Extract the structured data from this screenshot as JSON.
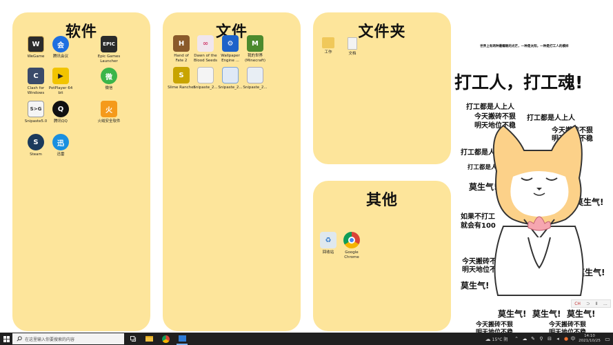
{
  "fences": {
    "software": {
      "title": "软件",
      "icons": [
        {
          "label": "WeGame",
          "color": "#2b2b2b",
          "glyph": "W"
        },
        {
          "label": "腾讯会议",
          "color": "#1e6fe0",
          "glyph": "会"
        },
        {
          "label": "Epic Games\nLauncher",
          "color": "#2a2a2a",
          "glyph": "EPIC"
        },
        {
          "label": "Clash for\nWindows",
          "color": "#3a4a6a",
          "glyph": "C"
        },
        {
          "label": "PotPlayer 64\nbit",
          "color": "#f2c400",
          "glyph": "▶"
        },
        {
          "label": "微信",
          "color": "#3bb54a",
          "glyph": "微"
        },
        {
          "label": "Snipaste5.0",
          "color": "#f5f5f5",
          "glyph": "S>G"
        },
        {
          "label": "腾讯QQ",
          "color": "#111111",
          "glyph": "Q"
        },
        {
          "label": "火绒安全软件",
          "color": "#f59a1b",
          "glyph": "火"
        },
        {
          "label": "Steam",
          "color": "#1b3a5c",
          "glyph": "S"
        },
        {
          "label": "迅雷",
          "color": "#1a8fe0",
          "glyph": "迅"
        }
      ]
    },
    "files": {
      "title": "文件",
      "icons": [
        {
          "label": "Hand of\nFate 2",
          "color": "#8a5a2b",
          "glyph": "H"
        },
        {
          "label": "Dawn of the\nBlood Seeds",
          "color": "#f0e6ee",
          "glyph": "∞"
        },
        {
          "label": "Wallpaper\nEngine ...",
          "color": "#1d62c9",
          "glyph": "⚙"
        },
        {
          "label": "我的世界\n(Minecraft)",
          "color": "#4c8a2e",
          "glyph": "M"
        },
        {
          "label": "Slime Rancher",
          "color": "#c8a400",
          "glyph": "S"
        },
        {
          "label": "Snipaste_2...",
          "color": "#f4f4f4",
          "glyph": ""
        },
        {
          "label": "Snipaste_2...",
          "color": "#dfe9f6",
          "glyph": ""
        },
        {
          "label": "Snipaste_2...",
          "color": "#e8eef4",
          "glyph": ""
        }
      ]
    },
    "folders": {
      "title": "文件夹",
      "icons": [
        {
          "label": "工作",
          "color": "#f0c85a",
          "glyph": ""
        },
        {
          "label": "文档",
          "color": "#f3f3f3",
          "glyph": ""
        }
      ]
    },
    "other": {
      "title": "其他",
      "icons": [
        {
          "label": "回收站",
          "color": "#dfe8ee",
          "glyph": "♻"
        },
        {
          "label": "Google\nChrome",
          "color": "#ffffff",
          "glyph": ""
        }
      ]
    }
  },
  "wallpaper": {
    "subtitle": "世界上有两种最耀眼的光芒，一种是太阳，一种是打工人的模样",
    "headline": "打工人，打工魂!",
    "lines": [
      "打工都是人上人",
      "今天搬砖不狠",
      "明天地位不稳",
      "打工都是人上人",
      "今天搬砖不狠",
      "明天地位不稳",
      "打工都是人上人",
      "打工都是人上人",
      "莫生气!",
      "莫生气!",
      "如果不打工",
      "就会有100",
      "今天搬砖不狠",
      "明天地位不稳",
      "莫生气!",
      "莫生气!",
      "莫生气!",
      "莫生气!",
      "莫生气!",
      "今天搬砖不狠",
      "明天地位不稳",
      "今天搬砖不狠",
      "明天地位不稳"
    ]
  },
  "taskbar": {
    "search_placeholder": "在这里输入你要搜索的内容",
    "weather": "15°C 阴",
    "ime": "中",
    "time": "14:10",
    "date": "2021/10/25"
  },
  "ime_toolbar": [
    "CH",
    "⊃",
    "Ⅱ",
    "..."
  ]
}
